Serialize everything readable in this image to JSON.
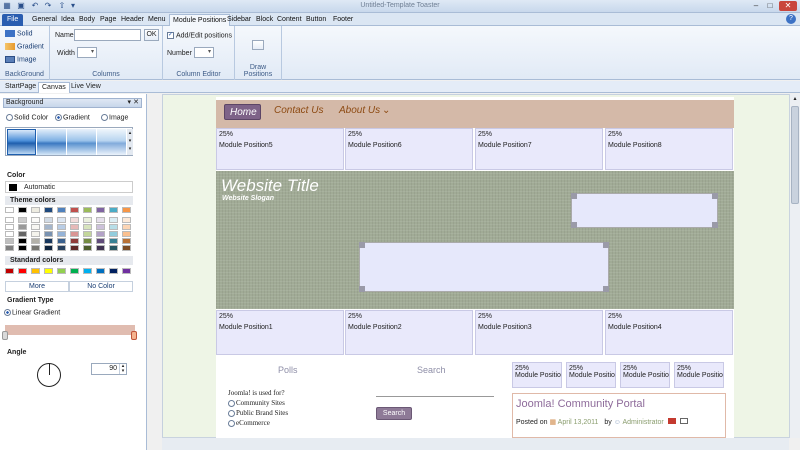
{
  "app": {
    "title": "Untitled-Template Toaster"
  },
  "menu": {
    "tabs": [
      "File",
      "General",
      "Idea",
      "Body",
      "Page",
      "Header",
      "Menu",
      "Module Positions",
      "Sidebar",
      "Block",
      "Content",
      "Button",
      "Footer"
    ]
  },
  "ribbon": {
    "background": {
      "label": "BackGround",
      "solid": "Solid",
      "gradient": "Gradient",
      "image": "Image"
    },
    "columns": {
      "label": "Columns",
      "name": "Name",
      "ok": "OK",
      "width": "Width"
    },
    "column_editor": {
      "label": "Column Editor",
      "add_edit": "Add/Edit positions",
      "number": "Number"
    },
    "draw_positions": {
      "label": "Draw Positions"
    }
  },
  "doc_tabs": [
    "StartPage",
    "Canvas",
    "Live View"
  ],
  "panel": {
    "title": "Background",
    "options": {
      "solid": "Solid Color",
      "gradient": "Gradient",
      "image": "Image"
    },
    "color_label": "Color",
    "automatic": "Automatic",
    "theme_colors": "Theme colors",
    "standard_colors": "Standard colors",
    "more": "More",
    "no_color": "No Color",
    "gradient_type": "Gradient Type",
    "linear_gradient": "Linear Gradient",
    "angle": "Angle",
    "angle_value": "90"
  },
  "colors": {
    "theme_top": [
      "#ffffff",
      "#000000",
      "#eeece1",
      "#1f497d",
      "#4f81bd",
      "#c0504d",
      "#9bbb59",
      "#8064a2",
      "#4bacc6",
      "#f79646"
    ],
    "standard": [
      "#c00000",
      "#ff0000",
      "#ffc000",
      "#ffff00",
      "#92d050",
      "#00b050",
      "#00b0f0",
      "#0070c0",
      "#002060",
      "#7030a0"
    ],
    "accent": "#2a5db0"
  },
  "site": {
    "nav": {
      "home": "Home",
      "contact": "Contact Us",
      "about": "About Us"
    },
    "top_modules": [
      {
        "pct": "25%",
        "name": "Module Position5"
      },
      {
        "pct": "25%",
        "name": "Module Position6"
      },
      {
        "pct": "25%",
        "name": "Module Position7"
      },
      {
        "pct": "25%",
        "name": "Module Position8"
      }
    ],
    "hero": {
      "title": "Website Title",
      "slogan": "Website Slogan"
    },
    "bottom_modules": [
      {
        "pct": "25%",
        "name": "Module Position1"
      },
      {
        "pct": "25%",
        "name": "Module Position2"
      },
      {
        "pct": "25%",
        "name": "Module Position3"
      },
      {
        "pct": "25%",
        "name": "Module Position4"
      }
    ],
    "polls": {
      "title": "Polls",
      "question": "Joomla! is used for?",
      "options": [
        "Community Sites",
        "Public Brand Sites",
        "eCommerce"
      ]
    },
    "search": {
      "title": "Search",
      "button": "Search"
    },
    "small_modules": [
      {
        "pct": "25%",
        "name": "Module Position"
      },
      {
        "pct": "25%",
        "name": "Module Position"
      },
      {
        "pct": "25%",
        "name": "Module Position"
      },
      {
        "pct": "25%",
        "name": "Module Position"
      }
    ],
    "article": {
      "title": "Joomla! Community Portal",
      "posted_on": "Posted on",
      "date": "April 13,2011",
      "by": "by",
      "author": "Administrator"
    }
  }
}
